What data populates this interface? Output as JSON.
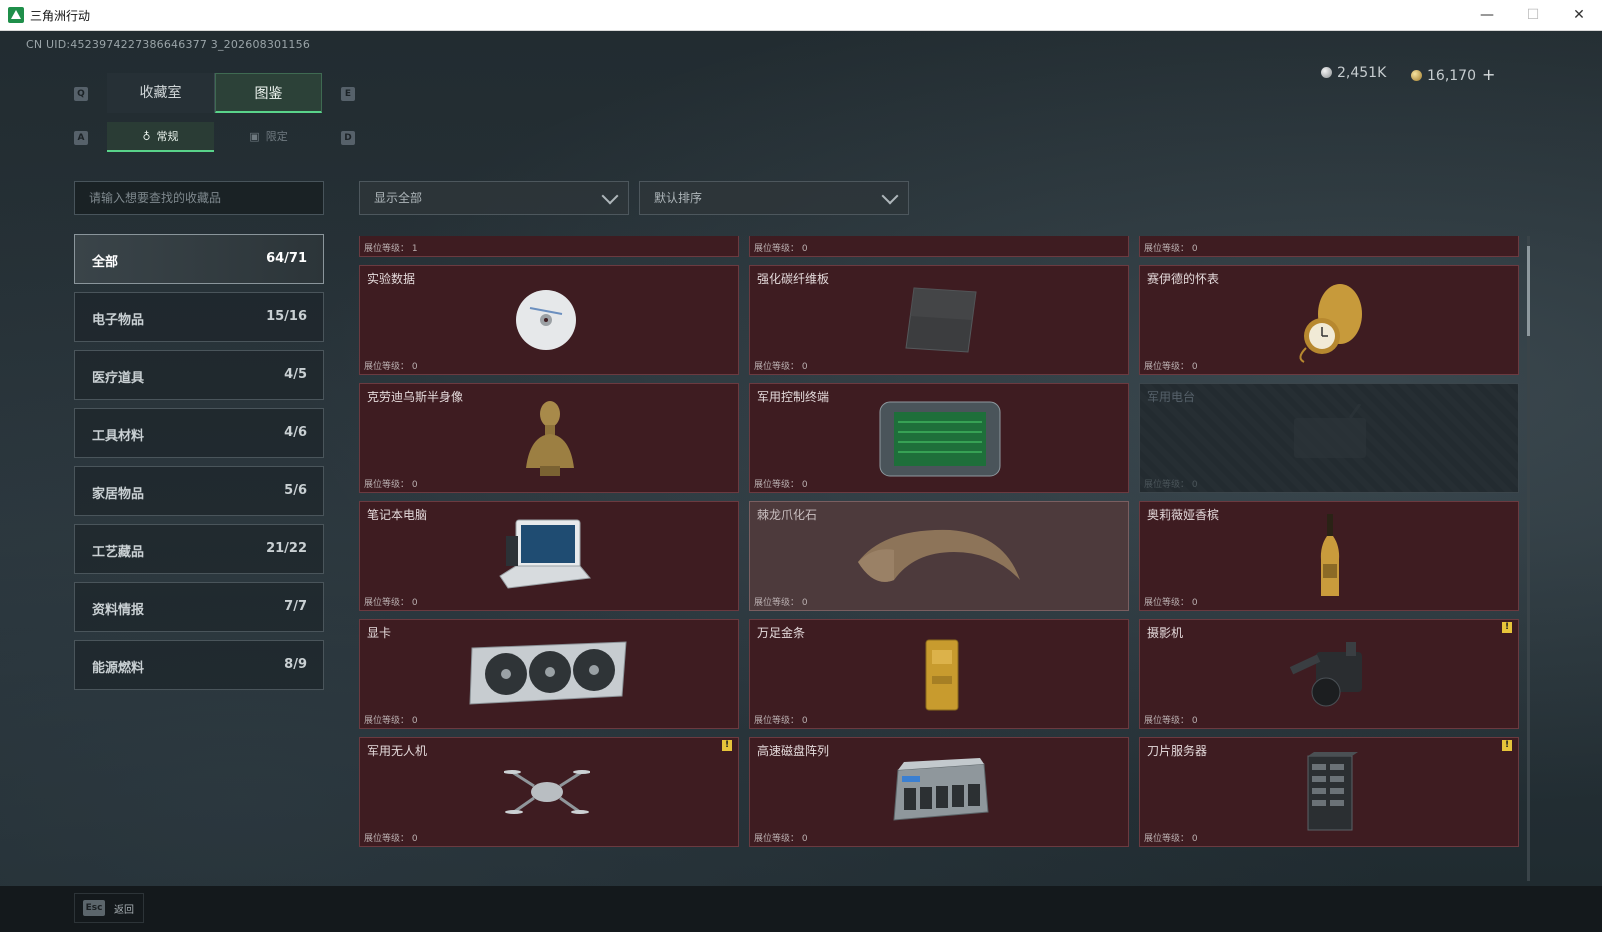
{
  "window": {
    "title": "三角洲行动",
    "min": "—",
    "max": "☐",
    "close": "✕"
  },
  "uid": "CN UID:4523974227386646377 3_202608301156",
  "currency": {
    "silver": "2,451K",
    "gold": "16,170",
    "plus": "+"
  },
  "keys": {
    "q": "Q",
    "e": "E",
    "a": "A",
    "d": "D"
  },
  "main_tabs": [
    "收藏室",
    "图鉴"
  ],
  "sub_tabs": [
    {
      "label": "常规",
      "icon": "bottle-icon"
    },
    {
      "label": "限定",
      "icon": "image-icon"
    }
  ],
  "search": {
    "placeholder": "请输入想要查找的收藏品"
  },
  "filters": {
    "show": "显示全部",
    "sort": "默认排序"
  },
  "categories": [
    {
      "label": "全部",
      "count": "64/71"
    },
    {
      "label": "电子物品",
      "count": "15/16"
    },
    {
      "label": "医疗道具",
      "count": "4/5"
    },
    {
      "label": "工具材料",
      "count": "4/6"
    },
    {
      "label": "家居物品",
      "count": "5/6"
    },
    {
      "label": "工艺藏品",
      "count": "21/22"
    },
    {
      "label": "资料情报",
      "count": "7/7"
    },
    {
      "label": "能源燃料",
      "count": "8/9"
    }
  ],
  "top_strip": [
    "展位等级： 1",
    "展位等级： 0",
    "展位等级： 0"
  ],
  "items": [
    {
      "name": "实验数据",
      "level": "展位等级： 0",
      "icon": "disc-icon"
    },
    {
      "name": "强化碳纤维板",
      "level": "展位等级： 0",
      "icon": "carbon-plate-icon"
    },
    {
      "name": "赛伊德的怀表",
      "level": "展位等级： 0",
      "icon": "pocket-watch-icon"
    },
    {
      "name": "克劳迪乌斯半身像",
      "level": "展位等级： 0",
      "icon": "bust-icon"
    },
    {
      "name": "军用控制终端",
      "level": "展位等级： 0",
      "icon": "control-terminal-icon"
    },
    {
      "name": "军用电台",
      "level": "展位等级： 0",
      "icon": "radio-icon"
    },
    {
      "name": "笔记本电脑",
      "level": "展位等级： 0",
      "icon": "laptop-icon"
    },
    {
      "name": "棘龙爪化石",
      "level": "展位等级： 0",
      "icon": "claw-fossil-icon"
    },
    {
      "name": "奥莉薇娅香槟",
      "level": "展位等级： 0",
      "icon": "champagne-icon"
    },
    {
      "name": "显卡",
      "level": "展位等级： 0",
      "icon": "gpu-icon"
    },
    {
      "name": "万足金条",
      "level": "展位等级： 0",
      "icon": "gold-bar-icon"
    },
    {
      "name": "摄影机",
      "level": "展位等级： 0",
      "icon": "camera-icon",
      "warn": "!"
    },
    {
      "name": "军用无人机",
      "level": "展位等级： 0",
      "icon": "drone-icon",
      "warn": "!"
    },
    {
      "name": "高速磁盘阵列",
      "level": "展位等级： 0",
      "icon": "disk-array-icon"
    },
    {
      "name": "刀片服务器",
      "level": "展位等级： 0",
      "icon": "blade-server-icon",
      "warn": "!"
    }
  ],
  "bottom": {
    "esc": "Esc",
    "back": "返回"
  }
}
